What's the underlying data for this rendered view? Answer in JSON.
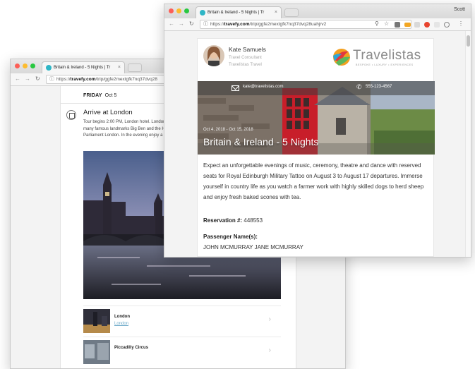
{
  "browser": {
    "tab_title": "Britain & Ireland - 5 Nights | Tr",
    "tab_close": "×",
    "url_domain": "travefy.com",
    "url_prefix": "https://",
    "url_path_front": "/trip/ggfe2mextgfk7nq37dvq28uahjrv2",
    "url_path_back": "/trip/ggfe2mextgfk7nq37dvq28",
    "profile_name": "Scott"
  },
  "itinerary": {
    "day_label": "FRIDAY",
    "day_date": "Oct 5",
    "event_title": "Arrive at London",
    "event_description": "Tour begins 2:00 PM, London hotel. London to see many famous landmarks Big Ben and the Houses of Parliament London. In the evening enjoy a welcome",
    "places": [
      {
        "title": "London",
        "subtitle": "London"
      },
      {
        "title": "Piccadilly Circus",
        "subtitle": ""
      }
    ]
  },
  "agent": {
    "name": "Kate Samuels",
    "role": "Travel Consultant",
    "company": "Travelistas Travel",
    "email": "kate@travelistas.com",
    "phone": "555-123-4567"
  },
  "brand": {
    "name": "Travelistas",
    "tagline": "BESPOKE • LUXURY • EXPERIENCES"
  },
  "trip": {
    "dates": "Oct 4, 2018 - Oct 15, 2018",
    "title": "Britain & Ireland - 5 Nights",
    "description": "Expect an unforgettable evenings of music, ceremony, theatre and dance with reserved seats for Royal Edinburgh Military Tattoo on August 3 to August 17 departures. Immerse yourself in country life as you watch a farmer work with highly skilled dogs to herd sheep and enjoy fresh baked scones with tea.",
    "reservation_label": "Reservation #:",
    "reservation_number": "448553",
    "passenger_label": "Passenger Name(s):",
    "passenger_names": "JOHN MCMURRAY JANE MCMURRAY"
  },
  "colors": {
    "accent": "#2fb6c6",
    "link": "#6aa8c8",
    "phone_box": "#c81e2a"
  },
  "icons": {
    "back": "←",
    "forward": "→",
    "reload": "↻",
    "lock": "🔒",
    "search": "⚲",
    "star": "☆",
    "more": "⋮",
    "chevron": "›",
    "phone": "✆"
  }
}
